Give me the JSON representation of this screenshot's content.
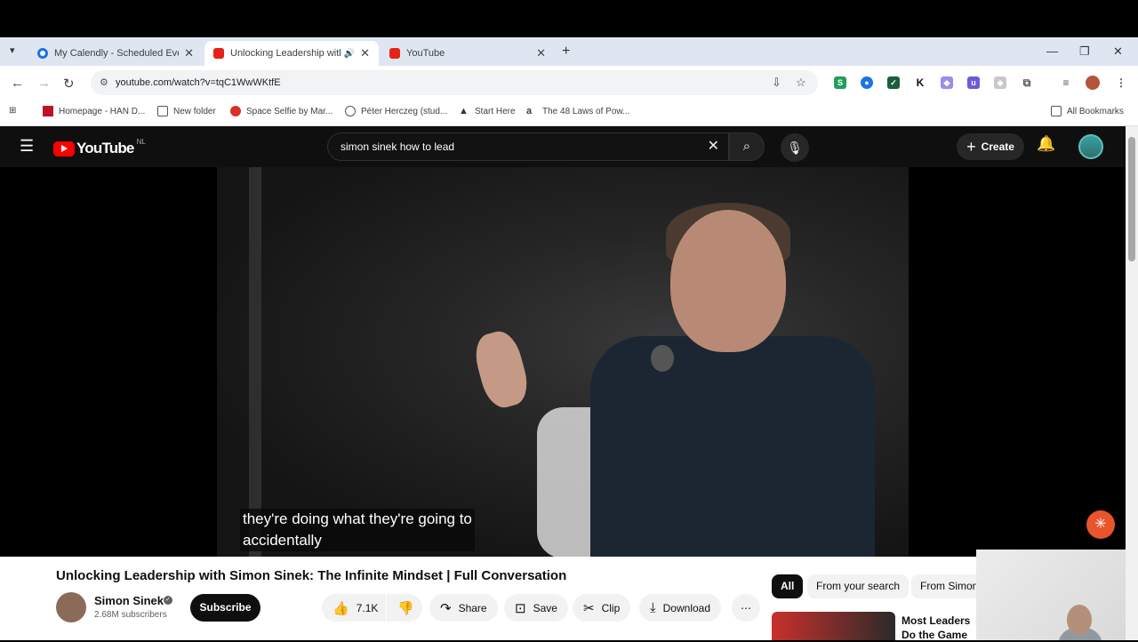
{
  "browser": {
    "tabs": [
      {
        "title": "My Calendly - Scheduled Events",
        "icon": "calendly-icon"
      },
      {
        "title": "Unlocking Leadership with Simon",
        "icon": "youtube-icon",
        "audio": true
      },
      {
        "title": "YouTube",
        "icon": "youtube-icon"
      }
    ],
    "url": "youtube.com/watch?v=tqC1WwWKtfE",
    "bookmarks": [
      "Homepage - HAN D...",
      "New folder",
      "Space Selfie by Mar...",
      "Péter Herczeg (stud...",
      "Start Here",
      "The 48 Laws of Pow..."
    ],
    "all_bookmarks": "All Bookmarks"
  },
  "youtube": {
    "logo_text": "YouTube",
    "region": "NL",
    "search_value": "simon sinek how to lead",
    "create_label": "Create"
  },
  "player": {
    "caption_line1": "they're doing what they're going to",
    "caption_line2": "accidentally"
  },
  "video": {
    "title": "Unlocking Leadership with Simon Sinek: The Infinite Mindset | Full Conversation",
    "channel": "Simon Sinek",
    "subscribers": "2.68M subscribers",
    "subscribe_label": "Subscribe",
    "likes": "7.1K",
    "share_label": "Share",
    "save_label": "Save",
    "clip_label": "Clip",
    "download_label": "Download"
  },
  "sidebar": {
    "chips": [
      "All",
      "From your search",
      "From Simon"
    ],
    "rec_title": "Most Leaders Do the Game They're"
  }
}
